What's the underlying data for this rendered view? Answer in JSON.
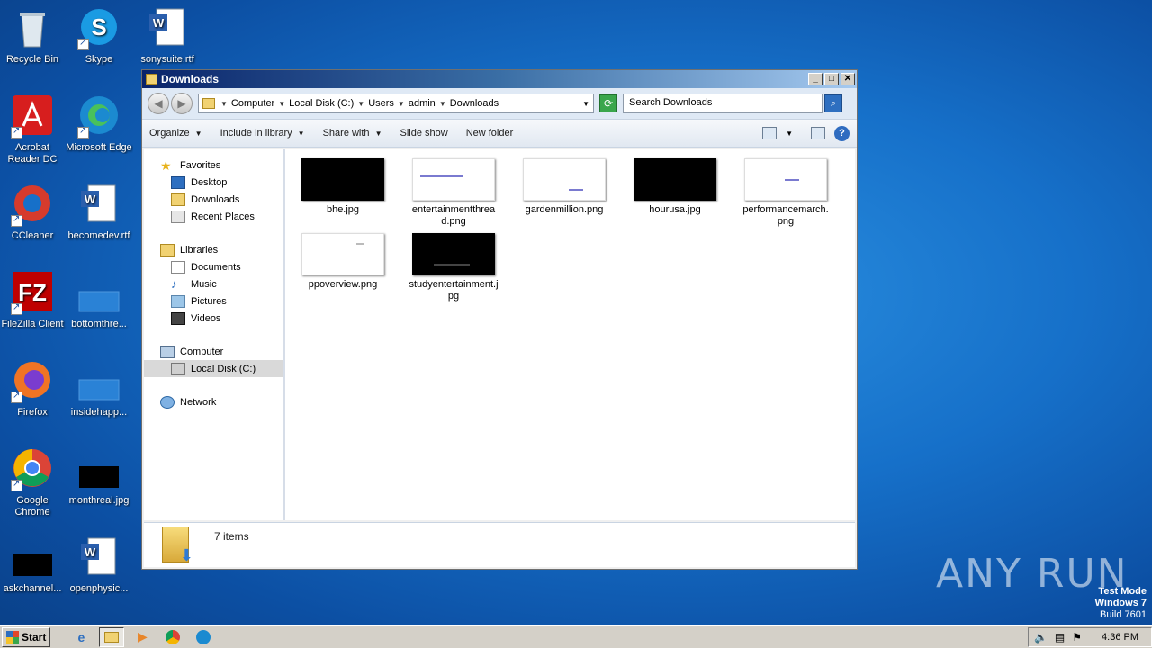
{
  "desktop": {
    "icons": [
      {
        "label": "Recycle Bin",
        "icon": "recycle-bin-icon"
      },
      {
        "label": "Skype",
        "icon": "skype-icon"
      },
      {
        "label": "sonysuite.rtf",
        "icon": "word-document-icon"
      },
      {
        "label": "Acrobat Reader DC",
        "icon": "acrobat-icon"
      },
      {
        "label": "Microsoft Edge",
        "icon": "edge-icon"
      },
      {
        "label": "CCleaner",
        "icon": "ccleaner-icon"
      },
      {
        "label": "becomedev.rtf",
        "icon": "word-document-icon"
      },
      {
        "label": "FileZilla Client",
        "icon": "filezilla-icon"
      },
      {
        "label": "bottomthre...",
        "icon": "blank-file-icon"
      },
      {
        "label": "Firefox",
        "icon": "firefox-icon"
      },
      {
        "label": "insidehapp...",
        "icon": "blank-file-icon"
      },
      {
        "label": "Google Chrome",
        "icon": "chrome-icon"
      },
      {
        "label": "monthreal.jpg",
        "icon": "image-thumb-icon"
      },
      {
        "label": "askchannel...",
        "icon": "image-thumb-icon"
      },
      {
        "label": "openphysic...",
        "icon": "word-document-icon"
      }
    ]
  },
  "window": {
    "title": "Downloads",
    "address": [
      "Computer",
      "Local Disk (C:)",
      "Users",
      "admin",
      "Downloads"
    ],
    "search_placeholder": "Search Downloads",
    "commands": [
      "Organize",
      "Include in library",
      "Share with",
      "Slide show",
      "New folder"
    ],
    "nav": {
      "favorites": "Favorites",
      "favorites_items": [
        "Desktop",
        "Downloads",
        "Recent Places"
      ],
      "libraries": "Libraries",
      "libraries_items": [
        "Documents",
        "Music",
        "Pictures",
        "Videos"
      ],
      "computer": "Computer",
      "computer_items": [
        "Local Disk (C:)"
      ],
      "network": "Network"
    },
    "files": [
      {
        "name": "bhe.jpg",
        "thumb": "black"
      },
      {
        "name": "entertainmentthread.png",
        "thumb": "white"
      },
      {
        "name": "gardenmillion.png",
        "thumb": "white"
      },
      {
        "name": "hourusa.jpg",
        "thumb": "black"
      },
      {
        "name": "performancemarch.png",
        "thumb": "white"
      },
      {
        "name": "ppoverview.png",
        "thumb": "white"
      },
      {
        "name": "studyentertainment.jpg",
        "thumb": "black"
      }
    ],
    "status": "7 items"
  },
  "taskbar": {
    "start": "Start",
    "clock": "4:36 PM"
  },
  "watermark": {
    "line1": "Test Mode",
    "line2": "Windows 7",
    "line3": "Build 7601",
    "brand": "ANY RUN"
  }
}
